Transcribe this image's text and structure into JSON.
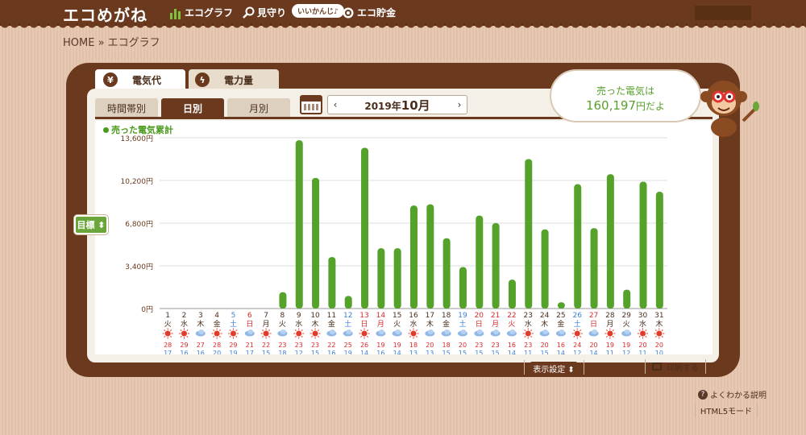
{
  "header": {
    "logo": "エコめがね",
    "nav": [
      {
        "label": "エコグラフ",
        "icon": "bar-chart-icon"
      },
      {
        "label": "見守り",
        "icon": "magnifier-icon"
      },
      {
        "label": "エコ貯金",
        "icon": "coin-icon"
      }
    ],
    "badge": "いいかんじ♪"
  },
  "breadcrumb": "HOME » エコグラフ",
  "tabs": {
    "main": [
      {
        "label": "電気代",
        "icon": "yen-icon",
        "active": true
      },
      {
        "label": "電力量",
        "icon": "lightning-icon",
        "active": false
      }
    ],
    "sub": [
      {
        "label": "時間帯別",
        "active": false
      },
      {
        "label": "日別",
        "active": true
      },
      {
        "label": "月別",
        "active": false
      }
    ]
  },
  "month_nav": {
    "prev": "‹",
    "year": "2019年",
    "month": "10月",
    "next": "›"
  },
  "speech": {
    "line1": "売った電気は",
    "amount": "160,197",
    "suffix": "円だよ"
  },
  "target_button": "目標 ⬍",
  "legend": "売った電気累計",
  "footer": {
    "display_settings": "表示設定 ⬍",
    "print": "印刷する",
    "faq": "よくわかる説明",
    "html5": "HTML5モード"
  },
  "colors": {
    "bar": "#55a22b",
    "brown": "#6b3a1e",
    "sat": "#3d7fd6",
    "sun": "#d62a2a"
  },
  "chart_data": {
    "type": "bar",
    "ylim": [
      0,
      13600
    ],
    "yticks": [
      "0円",
      "3,400円",
      "6,800円",
      "10,200円",
      "13,600円"
    ],
    "ytick_values": [
      0,
      3400,
      6800,
      10200,
      13600
    ],
    "days": [
      "1",
      "2",
      "3",
      "4",
      "5",
      "6",
      "7",
      "8",
      "9",
      "10",
      "11",
      "12",
      "13",
      "14",
      "15",
      "16",
      "17",
      "18",
      "19",
      "20",
      "21",
      "22",
      "23",
      "24",
      "25",
      "26",
      "27",
      "28",
      "29",
      "30",
      "31"
    ],
    "weekdays": [
      "火",
      "水",
      "木",
      "金",
      "土",
      "日",
      "月",
      "火",
      "水",
      "木",
      "金",
      "土",
      "日",
      "月",
      "火",
      "水",
      "木",
      "金",
      "土",
      "日",
      "月",
      "火",
      "水",
      "木",
      "金",
      "土",
      "日",
      "月",
      "火",
      "水",
      "木"
    ],
    "day_colors": [
      "n",
      "n",
      "n",
      "n",
      "sat",
      "sun",
      "n",
      "n",
      "n",
      "n",
      "n",
      "sat",
      "sun",
      "sun",
      "n",
      "n",
      "n",
      "n",
      "sat",
      "sun",
      "sun",
      "sun",
      "n",
      "n",
      "n",
      "sat",
      "sun",
      "n",
      "n",
      "n",
      "n"
    ],
    "values": [
      0,
      0,
      0,
      0,
      0,
      0,
      0,
      1300,
      13400,
      10400,
      4100,
      1000,
      12800,
      4800,
      4800,
      8200,
      8300,
      5600,
      3300,
      7400,
      6800,
      2300,
      11900,
      6300,
      500,
      9900,
      6400,
      10700,
      1500,
      10100,
      9300
    ],
    "weather": [
      "sun",
      "sun",
      "cloud",
      "sun",
      "sun",
      "cloud",
      "sun",
      "cloud",
      "sun",
      "sun",
      "cloud",
      "cloud",
      "sun",
      "cloud",
      "cloud",
      "sun",
      "cloud",
      "cloud",
      "cloud",
      "cloud",
      "cloud",
      "cloud",
      "sun",
      "cloud",
      "cloud",
      "sun",
      "cloud",
      "sun",
      "cloud",
      "sun",
      "sun"
    ],
    "temp_high": [
      "28",
      "29",
      "27",
      "28",
      "29",
      "21",
      "22",
      "23",
      "23",
      "23",
      "22",
      "25",
      "26",
      "19",
      "19",
      "18",
      "20",
      "18",
      "20",
      "23",
      "23",
      "16",
      "23",
      "20",
      "16",
      "24",
      "20",
      "19",
      "19",
      "20",
      "20"
    ],
    "temp_low": [
      "17",
      "16",
      "16",
      "20",
      "19",
      "17",
      "15",
      "18",
      "12",
      "15",
      "16",
      "19",
      "14",
      "16",
      "14",
      "13",
      "13",
      "15",
      "15",
      "15",
      "15",
      "14",
      "11",
      "15",
      "14",
      "12",
      "14",
      "11",
      "12",
      "11",
      "10"
    ]
  }
}
